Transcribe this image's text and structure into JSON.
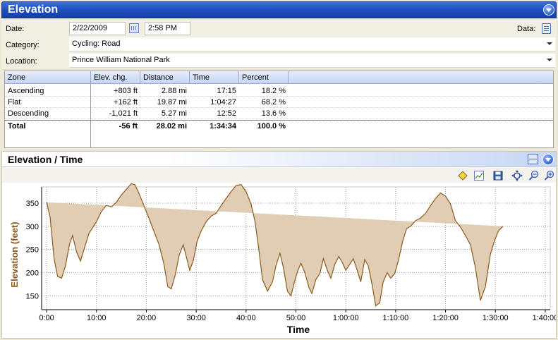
{
  "header": {
    "title": "Elevation"
  },
  "form": {
    "date_label": "Date:",
    "date_value": "2/22/2009",
    "time_value": "2:58 PM",
    "data_label": "Data:",
    "category_label": "Category:",
    "category_value": "Cycling: Road",
    "location_label": "Location:",
    "location_value": "Prince William National Park"
  },
  "table": {
    "columns": [
      "Zone",
      "Elev. chg.",
      "Distance",
      "Time",
      "Percent"
    ],
    "rows": [
      {
        "zone": "Ascending",
        "elev": "+803 ft",
        "distance": "2.88 mi",
        "time": "17:15",
        "percent": "18.2 %"
      },
      {
        "zone": "Flat",
        "elev": "+162 ft",
        "distance": "19.87 mi",
        "time": "1:04:27",
        "percent": "68.2 %"
      },
      {
        "zone": "Descending",
        "elev": "-1,021 ft",
        "distance": "5.27 mi",
        "time": "12:52",
        "percent": "13.6 %"
      }
    ],
    "total": {
      "zone": "Total",
      "elev": "-56 ft",
      "distance": "28.02 mi",
      "time": "1:34:34",
      "percent": "100.0 %"
    }
  },
  "chart_panel": {
    "title": "Elevation / Time",
    "toolbar_icons": [
      "diamond-marker-icon",
      "chart-select-icon",
      "save-icon",
      "fit-icon",
      "zoom-out-icon",
      "zoom-in-icon"
    ]
  },
  "chart_data": {
    "type": "area",
    "ylabel": "Elevation (feet)",
    "xlabel": "Time",
    "ylim": [
      120,
      385
    ],
    "xlim_minutes": [
      -1,
      101
    ],
    "yticks": [
      150,
      200,
      250,
      300,
      350
    ],
    "xticks": [
      "0:00",
      "10:00",
      "20:00",
      "30:00",
      "40:00",
      "50:00",
      "1:00:00",
      "1:10:00",
      "1:20:00",
      "1:30:00",
      "1:40:00"
    ],
    "grid": true,
    "fill_color": "#e0cdb4",
    "line_color": "#8a5a1e",
    "x_minutes": [
      0,
      0.7,
      1.5,
      2.2,
      3,
      3.8,
      4.6,
      5.2,
      6,
      6.8,
      7.5,
      8.5,
      10,
      11,
      12,
      13,
      14,
      15,
      16,
      17,
      17.7,
      18.5,
      19.5,
      20.5,
      21.5,
      22.5,
      23.5,
      24.3,
      25,
      25.8,
      26.6,
      27.4,
      28,
      28.7,
      29.4,
      30.2,
      31,
      32,
      33,
      34,
      35,
      36,
      37,
      38,
      39,
      40,
      41,
      41.8,
      42.5,
      43.3,
      44.3,
      45.3,
      46,
      46.8,
      47.5,
      48.3,
      49,
      49.7,
      50.4,
      51,
      51.8,
      52.6,
      53.2,
      54,
      54.8,
      55.5,
      56.3,
      57,
      57.8,
      58.6,
      59.3,
      60,
      60.8,
      61.5,
      62.3,
      63,
      63.8,
      64.5,
      65.3,
      66,
      66.8,
      67.5,
      68.3,
      69,
      69.8,
      70.6,
      71.4,
      72.2,
      73,
      74,
      75,
      76,
      77,
      78,
      79,
      80,
      81,
      82,
      83,
      84,
      85,
      86,
      87,
      88,
      89,
      89.8,
      90.6,
      91.5,
      92.5,
      93.5,
      94.5
    ],
    "y_feet": [
      352,
      320,
      230,
      192,
      188,
      215,
      262,
      280,
      245,
      225,
      250,
      285,
      310,
      332,
      345,
      342,
      352,
      368,
      380,
      392,
      390,
      372,
      345,
      318,
      290,
      262,
      220,
      170,
      165,
      195,
      238,
      260,
      235,
      205,
      225,
      268,
      290,
      310,
      322,
      328,
      345,
      360,
      375,
      388,
      390,
      375,
      348,
      310,
      255,
      185,
      160,
      180,
      215,
      242,
      210,
      160,
      150,
      180,
      205,
      220,
      200,
      168,
      155,
      185,
      198,
      230,
      205,
      188,
      218,
      235,
      222,
      205,
      218,
      230,
      205,
      180,
      228,
      215,
      172,
      128,
      135,
      180,
      200,
      188,
      198,
      228,
      268,
      295,
      300,
      312,
      318,
      328,
      345,
      360,
      372,
      365,
      348,
      312,
      298,
      280,
      260,
      210,
      140,
      170,
      240,
      268,
      290,
      300
    ]
  }
}
